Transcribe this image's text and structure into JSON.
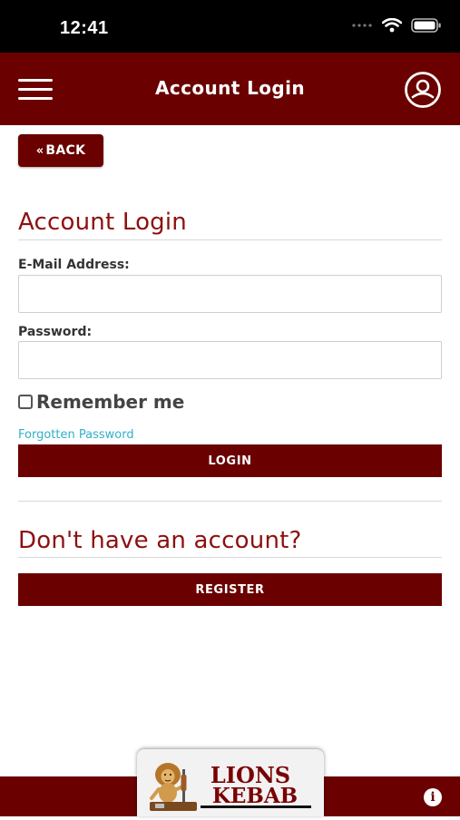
{
  "status_bar": {
    "time": "12:41"
  },
  "header": {
    "title": "Account Login",
    "menu_icon": "hamburger-menu-icon",
    "account_icon": "user-account-icon"
  },
  "back_button": {
    "chevron": "«",
    "label": "BACK"
  },
  "login": {
    "title": "Account Login",
    "email_label": "E-Mail Address:",
    "email_value": "",
    "password_label": "Password:",
    "password_value": "",
    "remember_label": "Remember me",
    "remember_checked": false,
    "forgot_link": "Forgotten Password",
    "login_button": "LOGIN"
  },
  "register": {
    "title": "Don't have an account?",
    "register_button": "REGISTER"
  },
  "footer": {
    "logo_line1": "LIONS",
    "logo_line2": "KEBAB",
    "info_glyph": "i"
  },
  "colors": {
    "brand": "#6a0000",
    "title_red": "#8f0f0f",
    "link": "#31b0c8"
  }
}
